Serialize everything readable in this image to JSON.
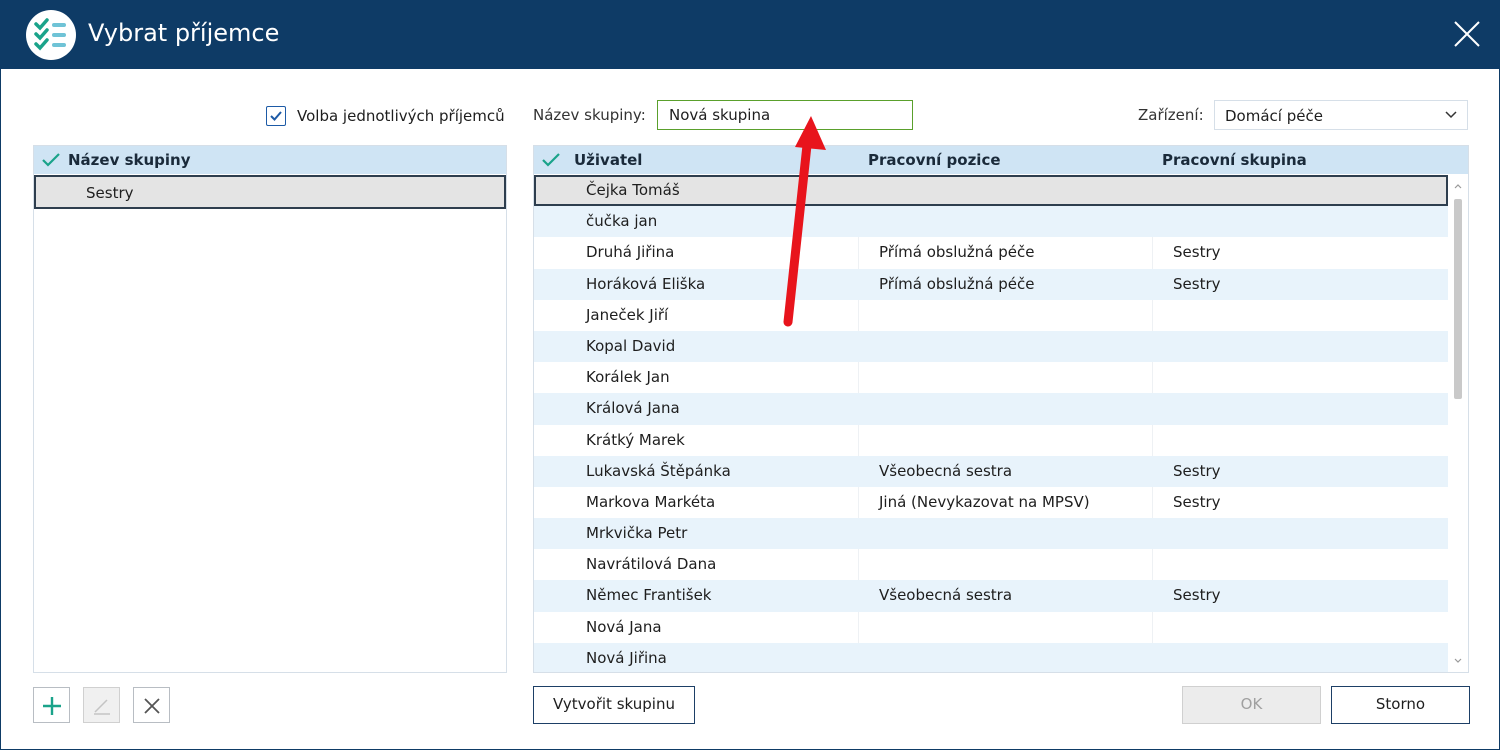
{
  "window": {
    "title": "Vybrat příjemce"
  },
  "left": {
    "checkbox_label": "Volba jednotlivých příjemců",
    "checkbox_checked": true,
    "header": "Název skupiny",
    "rows": [
      "Sestry"
    ]
  },
  "top": {
    "group_label": "Název skupiny:",
    "group_value": "Nová skupina",
    "device_label": "Zařízení:",
    "device_value": "Domácí péče"
  },
  "users": {
    "headers": [
      "Uživatel",
      "Pracovní pozice",
      "Pracovní skupina"
    ],
    "rows": [
      [
        "Čejka Tomáš",
        "",
        ""
      ],
      [
        "čučka jan",
        "",
        ""
      ],
      [
        "Druhá Jiřina",
        "Přímá obslužná péče",
        "Sestry"
      ],
      [
        "Horáková Eliška",
        "Přímá obslužná péče",
        "Sestry"
      ],
      [
        "Janeček Jiří",
        "",
        ""
      ],
      [
        "Kopal David",
        "",
        ""
      ],
      [
        "Korálek Jan",
        "",
        ""
      ],
      [
        "Králová Jana",
        "",
        ""
      ],
      [
        "Krátký Marek",
        "",
        ""
      ],
      [
        "Lukavská Štěpánka",
        "Všeobecná sestra",
        "Sestry"
      ],
      [
        "Markova Markéta",
        "Jiná (Nevykazovat na MPSV)",
        "Sestry"
      ],
      [
        "Mrkvička Petr",
        "",
        ""
      ],
      [
        "Navrátilová Dana",
        "",
        ""
      ],
      [
        "Němec František",
        "Všeobecná sestra",
        "Sestry"
      ],
      [
        "Nová Jana",
        "",
        ""
      ],
      [
        "Nová Jiřina",
        "",
        ""
      ]
    ]
  },
  "buttons": {
    "create_group": "Vytvořit skupinu",
    "ok": "OK",
    "cancel": "Storno"
  },
  "colors": {
    "titlebar": "#0e3b66",
    "header_bg": "#cfe4f4",
    "accent_check": "#1aa38a",
    "arrow": "#e8141c"
  }
}
